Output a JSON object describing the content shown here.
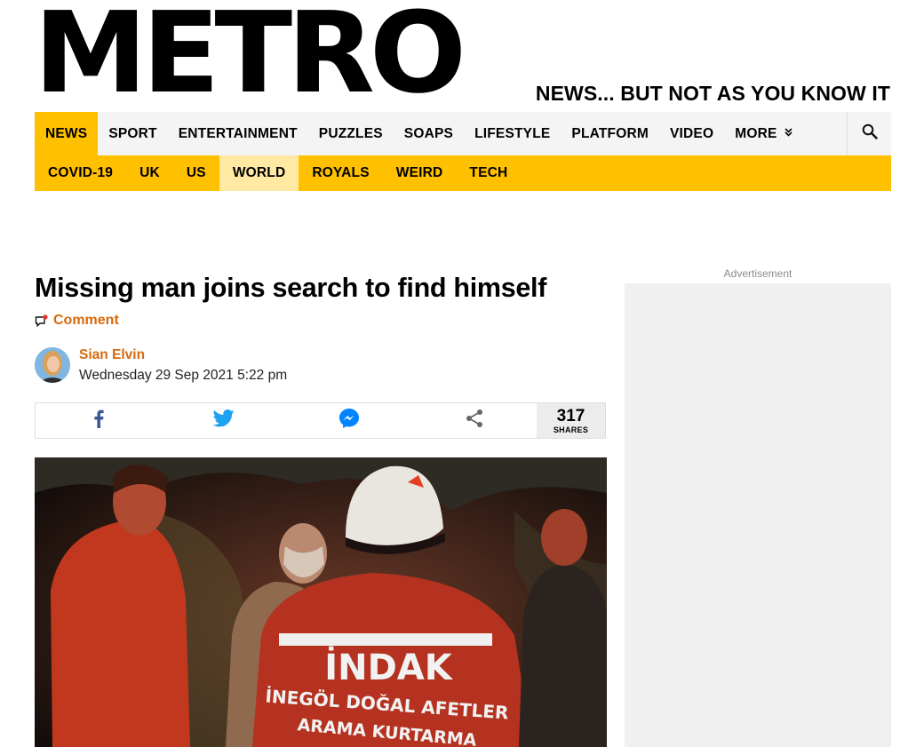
{
  "brand": {
    "logo": "METRO",
    "tagline": "NEWS... BUT NOT AS YOU KNOW IT"
  },
  "nav_primary": [
    {
      "label": "NEWS",
      "active": true
    },
    {
      "label": "SPORT",
      "active": false
    },
    {
      "label": "ENTERTAINMENT",
      "active": false
    },
    {
      "label": "PUZZLES",
      "active": false
    },
    {
      "label": "SOAPS",
      "active": false
    },
    {
      "label": "LIFESTYLE",
      "active": false
    },
    {
      "label": "PLATFORM",
      "active": false
    },
    {
      "label": "VIDEO",
      "active": false
    },
    {
      "label": "MORE",
      "active": false
    }
  ],
  "nav_secondary": [
    {
      "label": "COVID-19",
      "active": false
    },
    {
      "label": "UK",
      "active": false
    },
    {
      "label": "US",
      "active": false
    },
    {
      "label": "WORLD",
      "active": true
    },
    {
      "label": "ROYALS",
      "active": false
    },
    {
      "label": "WEIRD",
      "active": false
    },
    {
      "label": "TECH",
      "active": false
    }
  ],
  "icons": {
    "search": "search-icon",
    "more_chevron": "chevron-double-down-icon",
    "comment": "comment-icon",
    "facebook": "facebook-icon",
    "twitter": "twitter-icon",
    "messenger": "messenger-icon",
    "share": "share-icon"
  },
  "colors": {
    "accent_yellow": "#ffc000",
    "active_secondary": "#ffe9a3",
    "link_orange": "#d76a0e",
    "facebook_blue": "#3b5998",
    "twitter_blue": "#1da1f2",
    "messenger_blue": "#0084ff"
  },
  "article": {
    "headline": "Missing man joins search to find himself",
    "comment_label": "Comment",
    "author_name": "Sian Elvin",
    "published": "Wednesday 29 Sep 2021 5:22 pm",
    "share_count": "317",
    "share_label": "SHARES",
    "photo_text": {
      "vest_main": "İNDAK",
      "vest_line2": "İNEGÖL DOĞAL AFETLER",
      "vest_line3": "ARAMA KURTARMA"
    }
  },
  "ad": {
    "label": "Advertisement"
  }
}
